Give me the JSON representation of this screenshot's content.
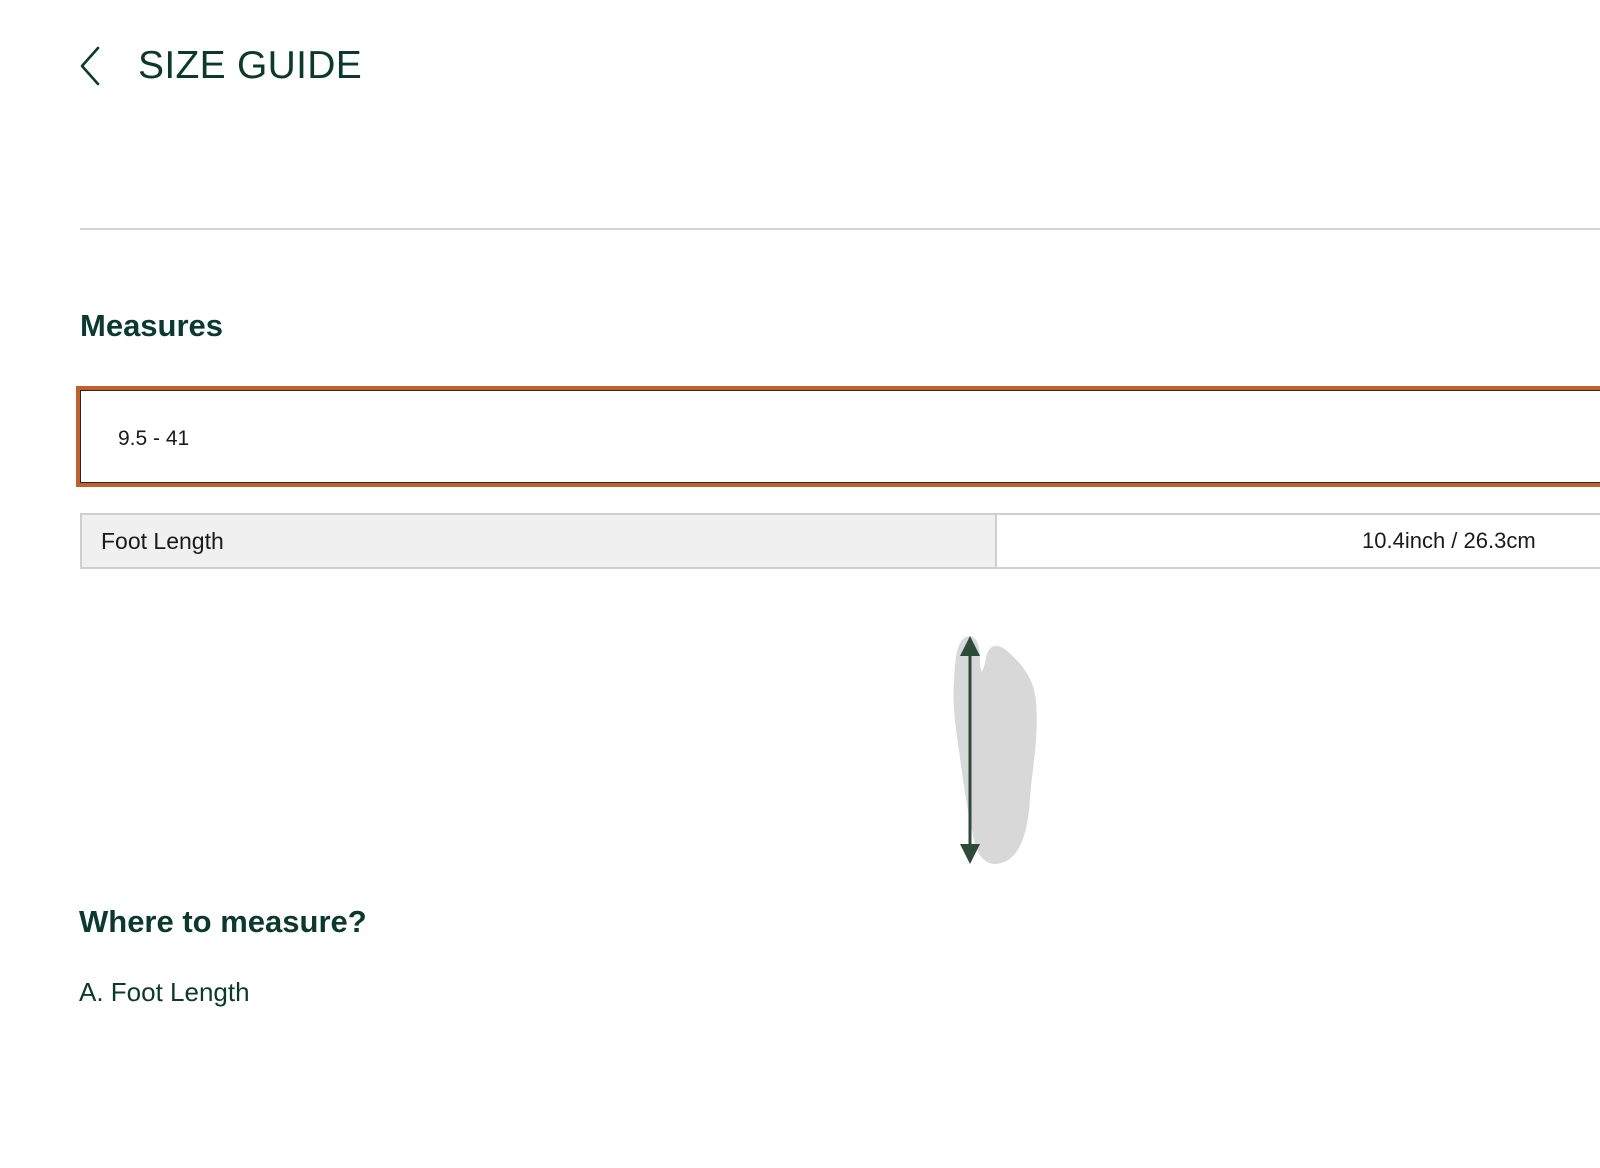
{
  "header": {
    "title": "SIZE GUIDE",
    "back_icon": "chevron-left-icon"
  },
  "measures": {
    "title": "Measures",
    "selected_size": "9.5 - 41",
    "rows": [
      {
        "label": "Foot Length",
        "value": "10.4inch / 26.3cm"
      }
    ]
  },
  "diagram": {
    "icon": "foot-length-diagram"
  },
  "where": {
    "title": "Where to measure?",
    "items": [
      "A. Foot Length"
    ]
  },
  "colors": {
    "text": "#0b3a2c",
    "select_border": "#c0602a",
    "table_label_bg": "#f0f0f0",
    "divider": "#d4d4d4"
  }
}
